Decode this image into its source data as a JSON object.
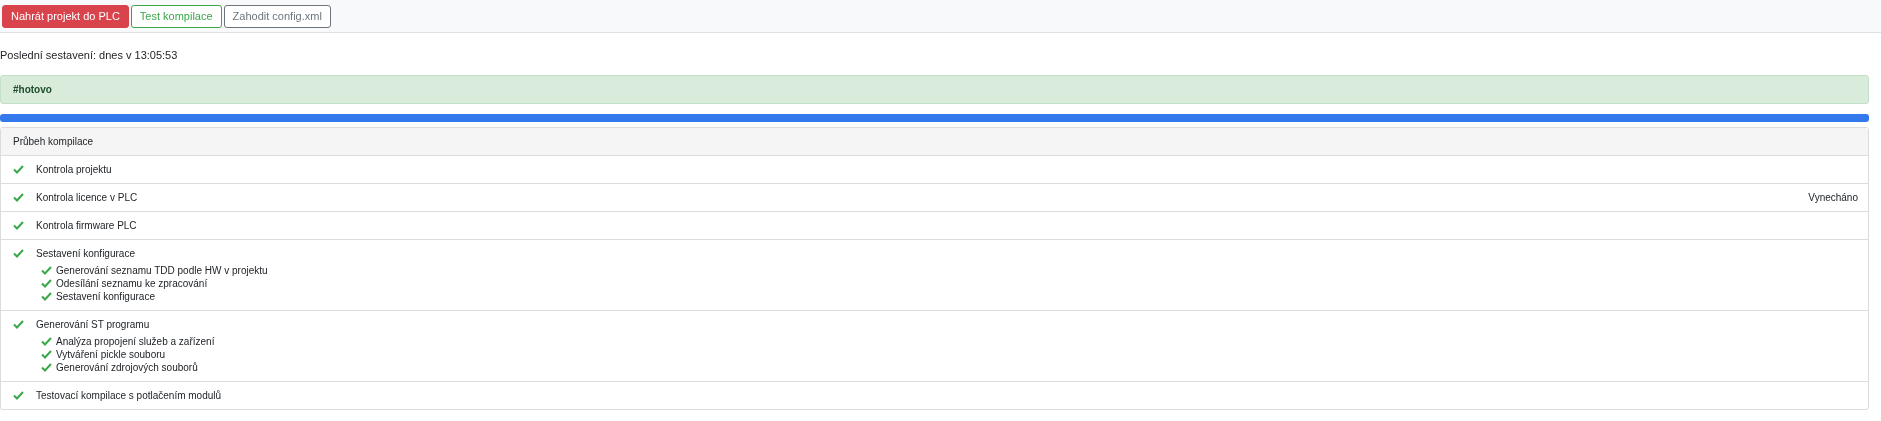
{
  "toolbar": {
    "buttons": [
      {
        "label": "Nahrát projekt do PLC",
        "kind": "danger"
      },
      {
        "label": "Test kompilace",
        "kind": "success"
      },
      {
        "label": "Zahodit config.xml",
        "kind": "secondary"
      }
    ]
  },
  "last_build": "Poslední sestavení: dnes v 13:05:53",
  "alert": {
    "text": "#hotovo",
    "kind": "success"
  },
  "progress": {
    "level": 1
  },
  "panel": {
    "title": "Průbeh kompilace",
    "steps": [
      {
        "label": "Kontrola projektu",
        "done": true
      },
      {
        "label": "Kontrola licence v PLC",
        "done": true,
        "note": "Vynecháno"
      },
      {
        "label": "Kontrola firmware PLC",
        "done": true
      },
      {
        "label": "Sestavení konfigurace",
        "done": true,
        "children": [
          {
            "label": "Generování seznamu TDD podle HW v projektu",
            "done": true
          },
          {
            "label": "Odesílání seznamu ke zpracování",
            "done": true
          },
          {
            "label": "Sestavení konfigurace",
            "done": true
          }
        ]
      },
      {
        "label": "Generování ST programu",
        "done": true,
        "children": [
          {
            "label": "Analýza propojení služeb a zařízení",
            "done": true
          },
          {
            "label": "Vytváření pickle souboru",
            "done": true
          },
          {
            "label": "Generování zdrojových souborů",
            "done": true
          }
        ]
      },
      {
        "label": "Testovací kompilace s potlačením modulů",
        "done": true
      }
    ]
  }
}
